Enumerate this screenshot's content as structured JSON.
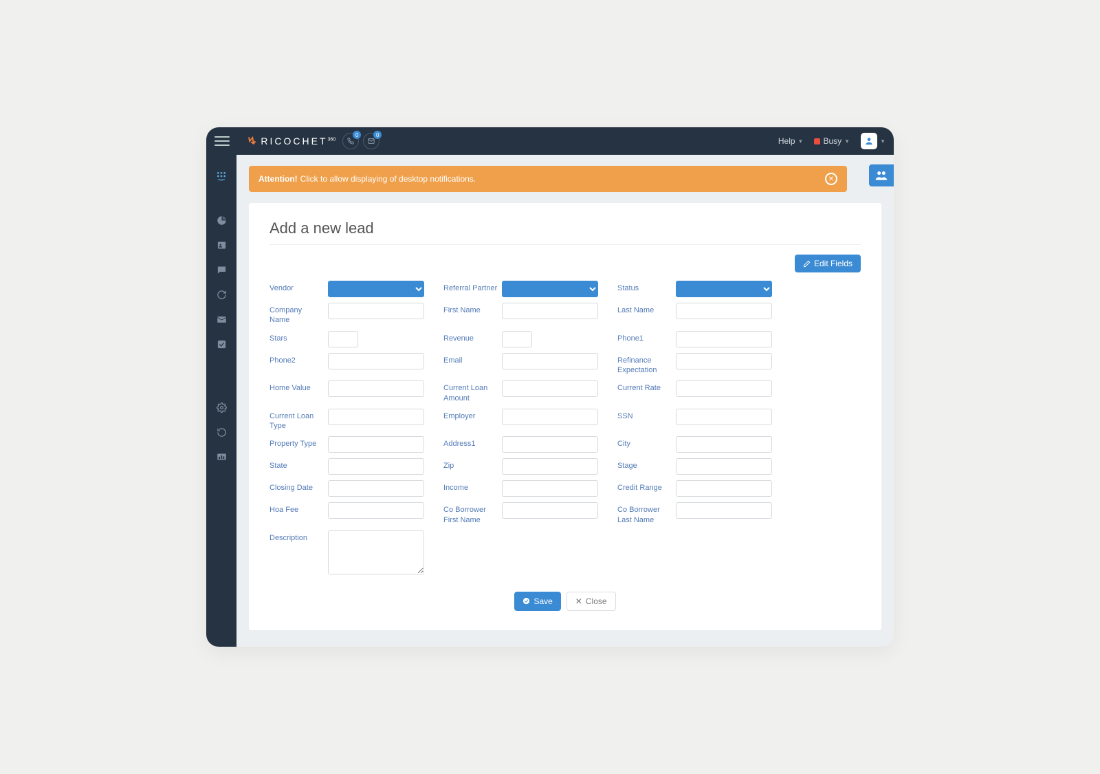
{
  "brand": {
    "name": "RICOCHET",
    "sup": "360"
  },
  "topbar": {
    "badge1": "0",
    "badge2": "0",
    "help": "Help",
    "status": "Busy"
  },
  "alert": {
    "strong": "Attention!",
    "text": "Click to allow displaying of desktop notifications."
  },
  "page": {
    "title": "Add a new lead",
    "edit_fields": "Edit Fields",
    "save": "Save",
    "close": "Close"
  },
  "fields": {
    "vendor": "Vendor",
    "referral_partner": "Referral Partner",
    "status": "Status",
    "company_name": "Company Name",
    "first_name": "First Name",
    "last_name": "Last Name",
    "stars": "Stars",
    "stars_val": "--",
    "revenue": "Revenue",
    "revenue_val": "--",
    "phone1": "Phone1",
    "phone2": "Phone2",
    "email": "Email",
    "refinance_expectation": "Refinance Expectation",
    "home_value": "Home Value",
    "current_loan_amount": "Current Loan Amount",
    "current_rate": "Current Rate",
    "current_loan_type": "Current Loan Type",
    "employer": "Employer",
    "ssn": "SSN",
    "property_type": "Property Type",
    "address1": "Address1",
    "city": "City",
    "state": "State",
    "zip": "Zip",
    "stage": "Stage",
    "closing_date": "Closing Date",
    "income": "Income",
    "credit_range": "Credit Range",
    "hoa_fee": "Hoa Fee",
    "co_borrower_first": "Co Borrower First Name",
    "co_borrower_last": "Co Borrower Last Name",
    "description": "Description"
  }
}
